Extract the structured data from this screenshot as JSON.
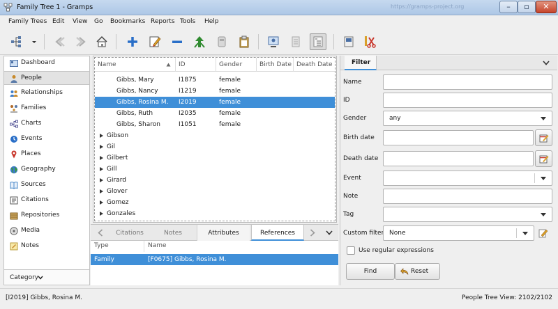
{
  "window": {
    "title": "Family Tree 1 - Gramps",
    "ghost_url": "https://gramps-project.org"
  },
  "menu": [
    "Family Trees",
    "Edit",
    "View",
    "Go",
    "Bookmarks",
    "Reports",
    "Tools",
    "Help"
  ],
  "sidebar": {
    "items": [
      {
        "label": "Dashboard",
        "icon": "dashboard-icon",
        "color": "#4a6fa5"
      },
      {
        "label": "People",
        "icon": "person-icon",
        "color": "#c88a2c"
      },
      {
        "label": "Relationships",
        "icon": "relationships-icon",
        "color": "#3d7bc8"
      },
      {
        "label": "Families",
        "icon": "family-icon",
        "color": "#b06a2a"
      },
      {
        "label": "Charts",
        "icon": "chart-icon",
        "color": "#5a5a9a"
      },
      {
        "label": "Events",
        "icon": "events-icon",
        "color": "#2a6fc8"
      },
      {
        "label": "Places",
        "icon": "places-icon",
        "color": "#c8352a"
      },
      {
        "label": "Geography",
        "icon": "globe-icon",
        "color": "#3a9a3a"
      },
      {
        "label": "Sources",
        "icon": "sources-icon",
        "color": "#4a88c8"
      },
      {
        "label": "Citations",
        "icon": "citations-icon",
        "color": "#555555"
      },
      {
        "label": "Repositories",
        "icon": "repositories-icon",
        "color": "#9a6a2a"
      },
      {
        "label": "Media",
        "icon": "media-icon",
        "color": "#666666"
      },
      {
        "label": "Notes",
        "icon": "notes-icon",
        "color": "#b89a3a"
      }
    ],
    "selected": 1,
    "category_label": "Category"
  },
  "tree": {
    "columns": [
      "Name",
      "ID",
      "Gender",
      "Birth Date",
      "Death Date"
    ],
    "people": [
      {
        "name": "Gibbs, Mary",
        "id": "I1875",
        "gender": "female"
      },
      {
        "name": "Gibbs, Nancy",
        "id": "I1219",
        "gender": "female"
      },
      {
        "name": "Gibbs, Rosina M.",
        "id": "I2019",
        "gender": "female"
      },
      {
        "name": "Gibbs, Ruth",
        "id": "I2035",
        "gender": "female"
      },
      {
        "name": "Gibbs, Sharon",
        "id": "I1051",
        "gender": "female"
      }
    ],
    "selected_person": 2,
    "groups": [
      "Gibson",
      "Gil",
      "Gilbert",
      "Gill",
      "Girard",
      "Glover",
      "Gomez",
      "Gonzales"
    ]
  },
  "bottom": {
    "tabs": [
      "Citations",
      "Notes",
      "Attributes",
      "References"
    ],
    "active_tab": "References",
    "columns": [
      "Type",
      "Name"
    ],
    "row": {
      "type": "Family",
      "name": "[F0675] Gibbs, Rosina M."
    }
  },
  "filter": {
    "tab": "Filter",
    "labels": {
      "name": "Name",
      "id": "ID",
      "gender": "Gender",
      "birth": "Birth date",
      "death": "Death date",
      "event": "Event",
      "note": "Note",
      "tag": "Tag",
      "custom": "Custom filter"
    },
    "gender_value": "any",
    "custom_value": "None",
    "regex_label": "Use regular expressions",
    "find_label": "Find",
    "reset_label": "Reset"
  },
  "status": {
    "left": "[I2019] Gibbs, Rosina M.",
    "right": "People Tree View: 2102/2102"
  },
  "colors": {
    "selection": "#3f8fd8",
    "accent_green": "#2f8a2f",
    "accent_blue": "#2a6fc8"
  }
}
